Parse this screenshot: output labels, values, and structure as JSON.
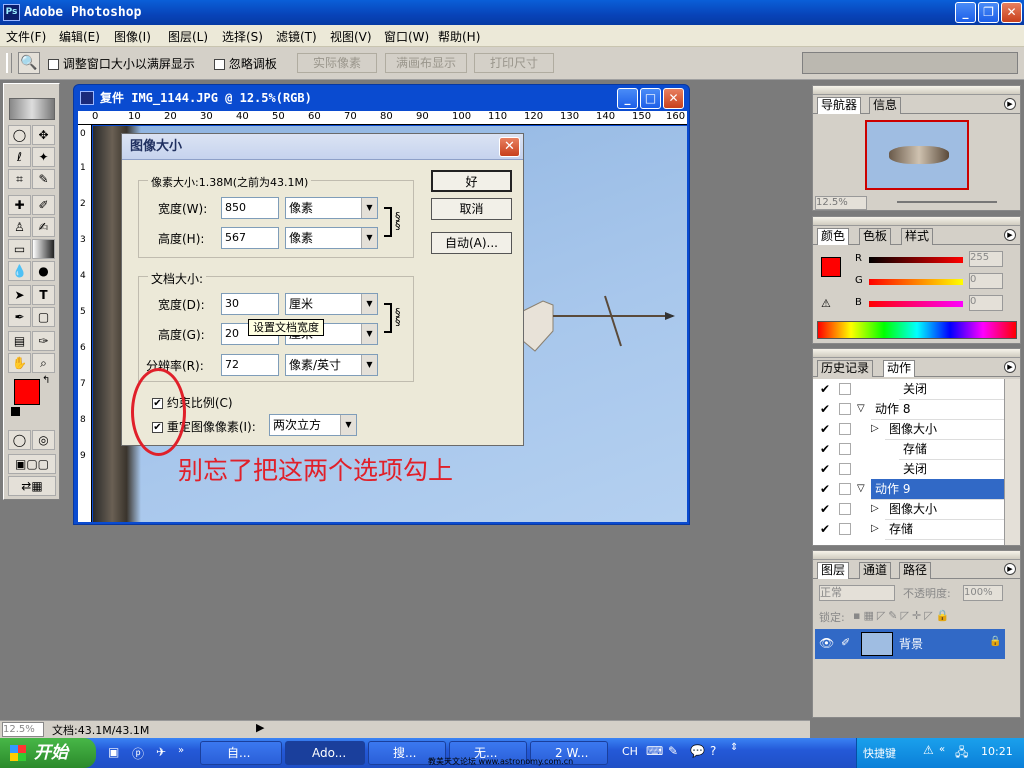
{
  "app": {
    "title": "Adobe Photoshop",
    "icon_label": "Ps",
    "window_buttons": {
      "minimize": "_",
      "restore": "❐",
      "close": "✕"
    }
  },
  "menu": [
    "文件(F)",
    "编辑(E)",
    "图像(I)",
    "图层(L)",
    "选择(S)",
    "滤镜(T)",
    "视图(V)",
    "窗口(W)",
    "帮助(H)"
  ],
  "options": {
    "fit_window_label": "调整窗口大小以满屏显示",
    "ignore_palettes_label": "忽略调板",
    "actual_pixels": "实际像素",
    "fit_screen": "满画布显示",
    "print_size": "打印尺寸"
  },
  "document": {
    "title": "复件 IMG_1144.JPG @ 12.5%(RGB)",
    "ruler_ticks": [
      "0",
      "10",
      "20",
      "30",
      "40",
      "50",
      "60",
      "70",
      "80",
      "90",
      "100",
      "110",
      "120",
      "130",
      "140",
      "150",
      "160"
    ],
    "left_ruler_ticks": [
      "0",
      "1",
      "2",
      "3",
      "4",
      "5",
      "6",
      "7",
      "8",
      "9"
    ]
  },
  "dialog": {
    "title": "图像大小",
    "pixel_dimensions_label": "像素大小:1.38M(之前为43.1M)",
    "width_label": "宽度(W):",
    "width_value": "850",
    "width_unit": "像素",
    "height_label": "高度(H):",
    "height_value": "567",
    "height_unit": "像素",
    "doc_size_label": "文档大小:",
    "doc_width_label": "宽度(D):",
    "doc_width_value": "30",
    "doc_width_unit": "厘米",
    "doc_height_label": "高度(G):",
    "doc_height_value": "20",
    "doc_height_unit": "厘米",
    "resolution_label": "分辨率(R):",
    "resolution_value": "72",
    "resolution_unit": "像素/英寸",
    "tooltip": "设置文档宽度",
    "ok": "好",
    "cancel": "取消",
    "auto": "自动(A)...",
    "constrain_label": "约束比例(C)",
    "resample_label": "重定图像像素(I):",
    "resample_method": "两次立方",
    "close_glyph": "✕"
  },
  "annotation": {
    "text": "别忘了把这两个选项勾上",
    "color": "#e0202a"
  },
  "navigator": {
    "tabs": [
      "导航器",
      "信息"
    ],
    "zoom": "12.5%"
  },
  "color_panel": {
    "tabs": [
      "颜色",
      "色板",
      "样式"
    ],
    "r_label": "R",
    "r_value": "255",
    "g_label": "G",
    "g_value": "0",
    "b_label": "B",
    "b_value": "0"
  },
  "history_panel": {
    "tabs": [
      "历史记录",
      "动作"
    ],
    "items": [
      {
        "label": "关闭",
        "indent": 3
      },
      {
        "label": "动作 8",
        "indent": 1,
        "expand": "▽"
      },
      {
        "label": "图像大小",
        "indent": 2,
        "expand": "▷"
      },
      {
        "label": "存储",
        "indent": 3
      },
      {
        "label": "关闭",
        "indent": 3
      },
      {
        "label": "动作 9",
        "indent": 1,
        "expand": "▽",
        "selected": true
      },
      {
        "label": "图像大小",
        "indent": 2,
        "expand": "▷"
      },
      {
        "label": "存储",
        "indent": 2,
        "expand": "▷"
      }
    ]
  },
  "layers_panel": {
    "tabs": [
      "图层",
      "通道",
      "路径"
    ],
    "blend_mode": "正常",
    "opacity_label": "不透明度:",
    "opacity_value": "100%",
    "lock_label": "锁定:",
    "layer_name": "背景"
  },
  "status": {
    "zoom": "12.5%",
    "doc_info": "文档:43.1M/43.1M"
  },
  "taskbar": {
    "start": "开始",
    "tasks": [
      "自...",
      "Ado...",
      "搜...",
      "无...",
      "2 W..."
    ],
    "lang": "CH",
    "shortcut": "快捷键",
    "clock": "10:21",
    "footer_text": "教美天文论坛 www.astronomy.com.cn"
  },
  "colors": {
    "foreground": "#ff0000",
    "background": "#ffffff",
    "sky": "#9cbfe6",
    "selection": "#3169c6"
  }
}
